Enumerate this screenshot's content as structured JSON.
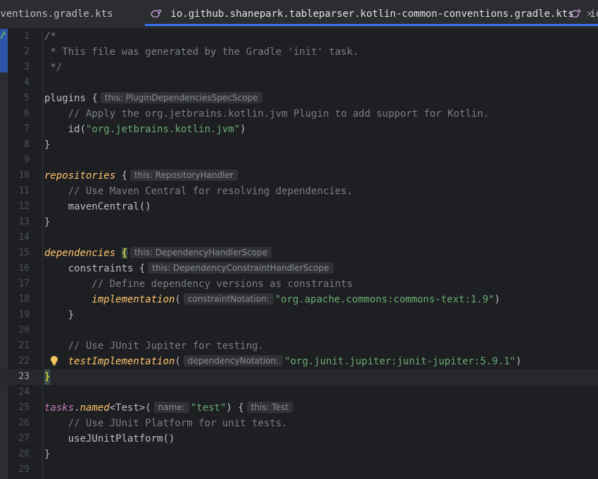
{
  "tabs": {
    "prev_label": "nventions.gradle.kts",
    "active_label": "io.github.shanepark.tableparser.kotlin-common-conventions.gradle.kts",
    "close_symbol": "×",
    "next_label": "io"
  },
  "editor": {
    "current_line": 23,
    "line_numbers": [
      "1",
      "2",
      "3",
      "4",
      "5",
      "6",
      "7",
      "8",
      "9",
      "10",
      "11",
      "12",
      "13",
      "14",
      "15",
      "16",
      "17",
      "18",
      "19",
      "20",
      "21",
      "22",
      "23",
      "24",
      "25",
      "26",
      "27",
      "28",
      "29"
    ],
    "code": {
      "l1": "/*",
      "l2": " * This file was generated by the Gradle 'init' task.",
      "l3": " */",
      "l5_kw": "plugins",
      "l5_brace": " {",
      "l5_hint": "this: PluginDependenciesSpecScope",
      "l6": "    // Apply the org.jetbrains.kotlin.jvm Plugin to add support for Kotlin.",
      "l7_fn": "    id(",
      "l7_str": "\"org.jetbrains.kotlin.jvm\"",
      "l7_close": ")",
      "l8": "}",
      "l10_kw": "repositories",
      "l10_brace": " {",
      "l10_hint": "this: RepositoryHandler",
      "l11": "    // Use Maven Central for resolving dependencies.",
      "l12": "    mavenCentral()",
      "l13": "}",
      "l15_kw": "dependencies",
      "l15_brace": "{",
      "l15_hint": "this: DependencyHandlerScope",
      "l16_kw": "    constraints",
      "l16_brace": " {",
      "l16_hint": "this: DependencyConstraintHandlerScope",
      "l17": "        // Define dependency versions as constraints",
      "l18_kw": "        implementation",
      "l18_open": "(",
      "l18_hint": "constraintNotation:",
      "l18_str": "\"org.apache.commons:commons-text:1.9\"",
      "l18_close": ")",
      "l19": "    }",
      "l21": "    // Use JUnit Jupiter for testing.",
      "l22_kw": "    testImplementation",
      "l22_open": "(",
      "l22_hint": "dependencyNotation:",
      "l22_str": "\"org.junit.jupiter:junit-jupiter:5.9.1\"",
      "l22_close": ")",
      "l23": "}",
      "l25_kw1": "tasks",
      "l25_dot": ".",
      "l25_kw2": "named",
      "l25_type": "<Test>(",
      "l25_hint1": "name:",
      "l25_str": "\"test\"",
      "l25_mid": ") {",
      "l25_hint2": "this: Test",
      "l26": "    // Use JUnit Platform for unit tests.",
      "l27": "    useJUnitPlatform()",
      "l28": "}"
    }
  },
  "icons": {
    "tab_file": "kotlin-gradle-file-icon",
    "gutter_run": "run-gradle-icon",
    "intention": "lightbulb-icon"
  },
  "colors": {
    "background": "#1e1f22",
    "accent": "#3574f0",
    "comment": "#7a7e85",
    "string": "#6aab73",
    "dsl_call": "#ffc66d"
  }
}
